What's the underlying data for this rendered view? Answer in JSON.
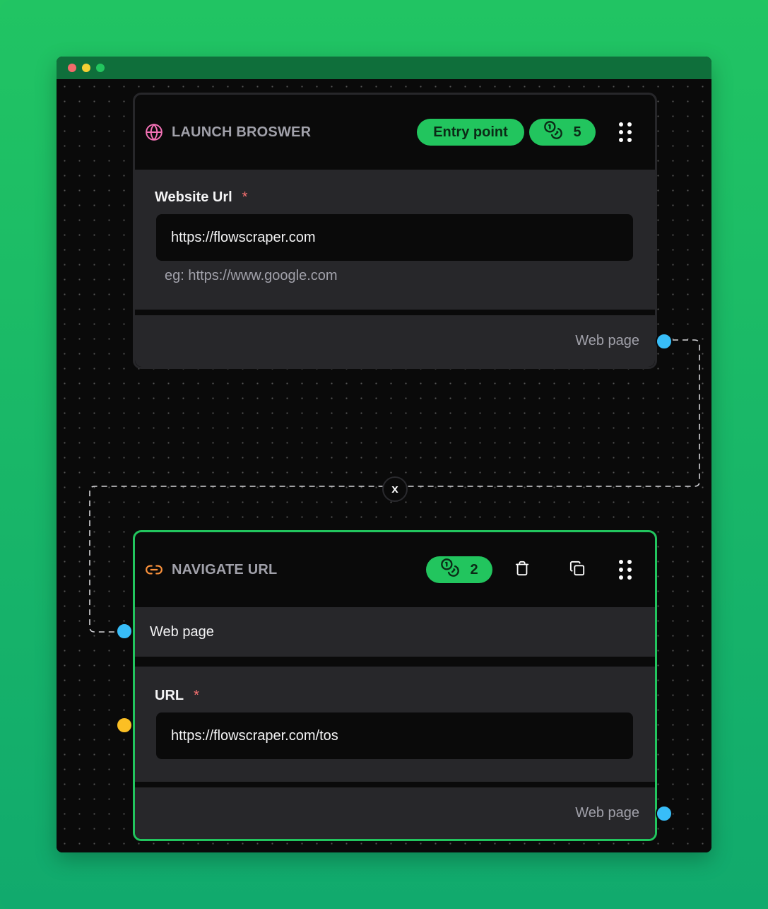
{
  "window": {
    "controls": [
      "close",
      "minimize",
      "maximize"
    ]
  },
  "colors": {
    "accent": "#22c55e",
    "canvas_bg": "#0a0a0a",
    "section_bg": "#27272a",
    "handle_web_page": "#38bdf8",
    "handle_string": "#fbbf24",
    "required": "#f87171",
    "launch_icon": "#f472b6",
    "navigate_icon": "#fb923c"
  },
  "nodes": [
    {
      "id": "launch-browser",
      "title": "LAUNCH BROSWER",
      "icon": "globe-icon",
      "entry_badge": "Entry point",
      "credits_icon": "coins-icon",
      "credits": "5",
      "selected": false,
      "inputs": [
        {
          "label": "Website Url",
          "required_mark": "*",
          "value": "https://flowscraper.com",
          "helper": "eg: https://www.google.com"
        }
      ],
      "outputs": [
        {
          "label": "Web page"
        }
      ]
    },
    {
      "id": "navigate-url",
      "title": "NAVIGATE URL",
      "icon": "link-icon",
      "credits_icon": "coins-icon",
      "credits": "2",
      "actions": [
        "delete-icon",
        "copy-icon",
        "drag-grip-icon"
      ],
      "selected": true,
      "input_ports": [
        {
          "label": "Web page"
        }
      ],
      "inputs": [
        {
          "label": "URL",
          "required_mark": "*",
          "value": "https://flowscraper.com/tos"
        }
      ],
      "outputs": [
        {
          "label": "Web page"
        }
      ]
    }
  ],
  "edge": {
    "delete_label": "x",
    "from": "launch-browser.Web page",
    "to": "navigate-url.Web page"
  }
}
